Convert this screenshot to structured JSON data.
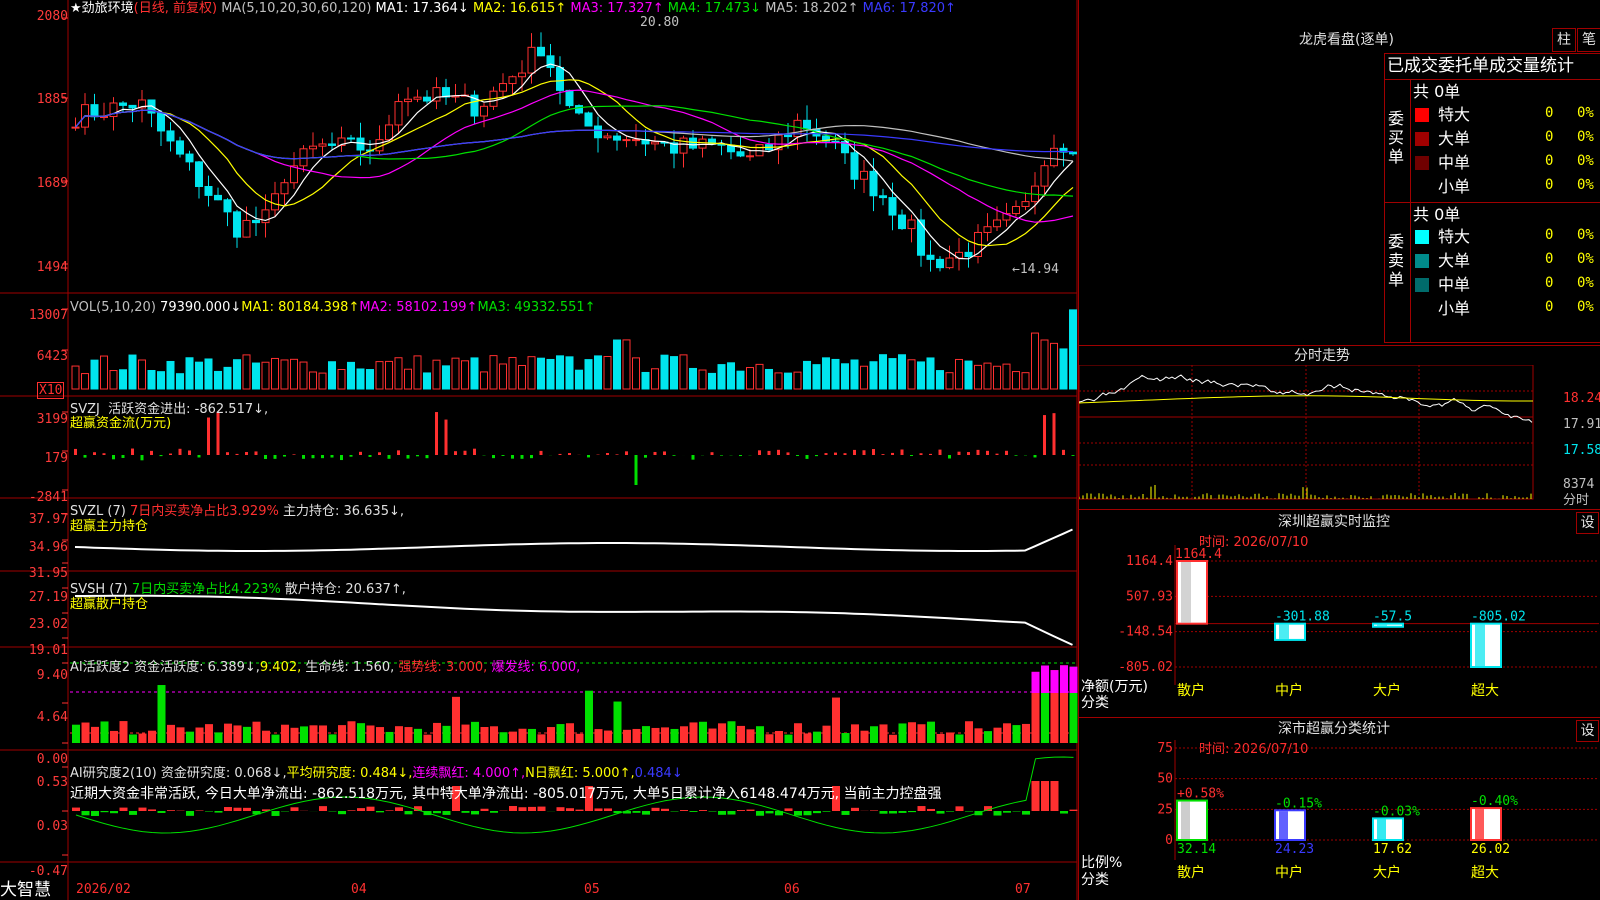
{
  "stock": {
    "name": "★劲旅环境",
    "mode": "(日线, 前复权)"
  },
  "colors": {
    "up": "#ff3030",
    "down": "#00e5ee",
    "grid": "#a00000",
    "yellow": "#ffff00",
    "magenta": "#ff00ff",
    "green": "#00e000",
    "blue": "#3a3aff",
    "white": "#ffffff"
  },
  "kline": {
    "ma_label": "MA(5,10,20,30,60,120)",
    "ma": [
      {
        "label": "MA1: 17.364↓",
        "color": "#ffffff"
      },
      {
        "label": "MA2: 16.615↑",
        "color": "#ffff00"
      },
      {
        "label": "MA3: 17.327↑",
        "color": "#ff00ff"
      },
      {
        "label": "MA4: 17.473↓",
        "color": "#00e000"
      },
      {
        "label": "MA5: 18.202↑",
        "color": "#c0c0c0"
      },
      {
        "label": "MA6: 17.820↑",
        "color": "#3a3aff"
      }
    ],
    "y_ticks": [
      "2080",
      "1885",
      "1689",
      "1494"
    ],
    "high_label": "20.80",
    "low_label": "←14.94"
  },
  "volume": {
    "label": "VOL(5,10,20)",
    "value": "79390.000↓",
    "ma": [
      {
        "label": "MA1: 80184.398↑",
        "color": "#ffff00"
      },
      {
        "label": "MA2: 58102.199↑",
        "color": "#ff00ff"
      },
      {
        "label": "MA3: 49332.551↑",
        "color": "#00e000"
      }
    ],
    "y_ticks": [
      "13007",
      "6423"
    ],
    "unit": "X10"
  },
  "svzj": {
    "title": "SVZJ",
    "desc": "活跃资金进出: -862.517↓,",
    "sub": "超赢资金流(万元)",
    "y_ticks": [
      "3199",
      "179",
      "-2841"
    ]
  },
  "svzl": {
    "title": "SVZL (7)",
    "desc1": "7日内买卖净占比3.929%",
    "desc2": "主力持仓: 36.635↓,",
    "sub": "超赢主力持仓",
    "y_ticks": [
      "37.97",
      "34.96",
      "31.95"
    ]
  },
  "svsh": {
    "title": "SVSH (7)",
    "desc1": "7日内买卖净占比4.223%",
    "desc2": "散户持仓: 20.637↑,",
    "sub": "超赢散户持仓",
    "y_ticks": [
      "27.19",
      "23.02",
      "19.01"
    ]
  },
  "aihyd": {
    "title": "AI活跃度2",
    "l1": "资金活跃度: 6.389↓,",
    "l2": "9.402,",
    "l3": "生命线: 1.560,",
    "l4": "强势线: 3.000,",
    "l5": "爆发线: 6.000,",
    "y_ticks": [
      "9.40",
      "4.64",
      "0.00"
    ]
  },
  "aiyjd": {
    "title": "AI研究度2(10)",
    "l1": "资金研究度: 0.068↓,",
    "l2": "平均研究度: 0.484↓,",
    "l3": "连续飘红: 4.000↑,",
    "l4": "N日飘红: 5.000↑,",
    "l5": "0.484↓",
    "comment": "近期大资金非常活跃, 今日大单净流出: -862.518万元, 其中特大单净流出: -805.017万元, 大单5日累计净入6148.474万元, 当前主力控盘强",
    "y_ticks": [
      "0.53",
      "0.03",
      "-0.47"
    ]
  },
  "xaxis": {
    "labels": [
      "2026/02",
      "04",
      "05",
      "06",
      "07"
    ],
    "logo": "大智慧"
  },
  "longhu": {
    "title": "龙虎看盘(逐单)",
    "btn1": "柱",
    "btn2": "笔",
    "subtitle": "已成交委托单成交量统计",
    "buy_label": "委买单",
    "sell_label": "委卖单",
    "buy_total": "共 0单",
    "sell_total": "共 0单",
    "buy_rows": [
      {
        "name": "特大",
        "count": "0",
        "pct": "0%",
        "color": "#ff0000"
      },
      {
        "name": "大单",
        "count": "0",
        "pct": "0%",
        "color": "#a00000"
      },
      {
        "name": "中单",
        "count": "0",
        "pct": "0%",
        "color": "#700000"
      },
      {
        "name": "小单",
        "count": "0",
        "pct": "0%",
        "color": "#000000"
      }
    ],
    "sell_rows": [
      {
        "name": "特大",
        "count": "0",
        "pct": "0%",
        "color": "#00ffff"
      },
      {
        "name": "大单",
        "count": "0",
        "pct": "0%",
        "color": "#008b8b"
      },
      {
        "name": "中单",
        "count": "0",
        "pct": "0%",
        "color": "#006b6b"
      },
      {
        "name": "小单",
        "count": "0",
        "pct": "0%",
        "color": "#000000"
      }
    ]
  },
  "fenshi": {
    "title": "分时走势",
    "p1": "18.24",
    "p2": "17.91",
    "p3": "17.58",
    "vol": "8374",
    "vol_unit": "分时"
  },
  "sz_monitor": {
    "title": "深圳超赢实时监控",
    "set": "设",
    "time": "时间: 2026/07/10",
    "y_ticks": [
      "1164.4",
      "507.93",
      "-148.54",
      "-805.02"
    ],
    "ylabel": "净额(万元)",
    "xlabel": "分类",
    "bars": [
      {
        "name": "散户",
        "value": 1164.4,
        "label": "1164.4"
      },
      {
        "name": "中户",
        "value": -301.88,
        "label": "-301.88"
      },
      {
        "name": "大户",
        "value": -57.5,
        "label": "-57.5"
      },
      {
        "name": "超大",
        "value": -805.02,
        "label": "-805.02"
      }
    ]
  },
  "sz_class": {
    "title": "深市超赢分类统计",
    "set": "设",
    "time": "时间: 2026/07/10",
    "y_ticks": [
      "75",
      "50",
      "25",
      "0"
    ],
    "ylabel": "比例%",
    "xlabel": "分类",
    "bars": [
      {
        "name": "散户",
        "value": 32.14,
        "label": "32.14",
        "chg": "+0.58%"
      },
      {
        "name": "中户",
        "value": 24.23,
        "label": "24.23",
        "chg": "-0.15%"
      },
      {
        "name": "大户",
        "value": 17.62,
        "label": "17.62",
        "chg": "-0.03%"
      },
      {
        "name": "超大",
        "value": 26.02,
        "label": "26.02",
        "chg": "-0.40%"
      }
    ]
  },
  "chart_data": {
    "type": "bar",
    "title": "深圳超赢实时监控",
    "categories": [
      "散户",
      "中户",
      "大户",
      "超大"
    ],
    "values": [
      1164.4,
      -301.88,
      -57.5,
      -805.02
    ],
    "xlabel": "分类",
    "ylabel": "净额(万元)",
    "ylim": [
      -805.02,
      1164.4
    ]
  }
}
